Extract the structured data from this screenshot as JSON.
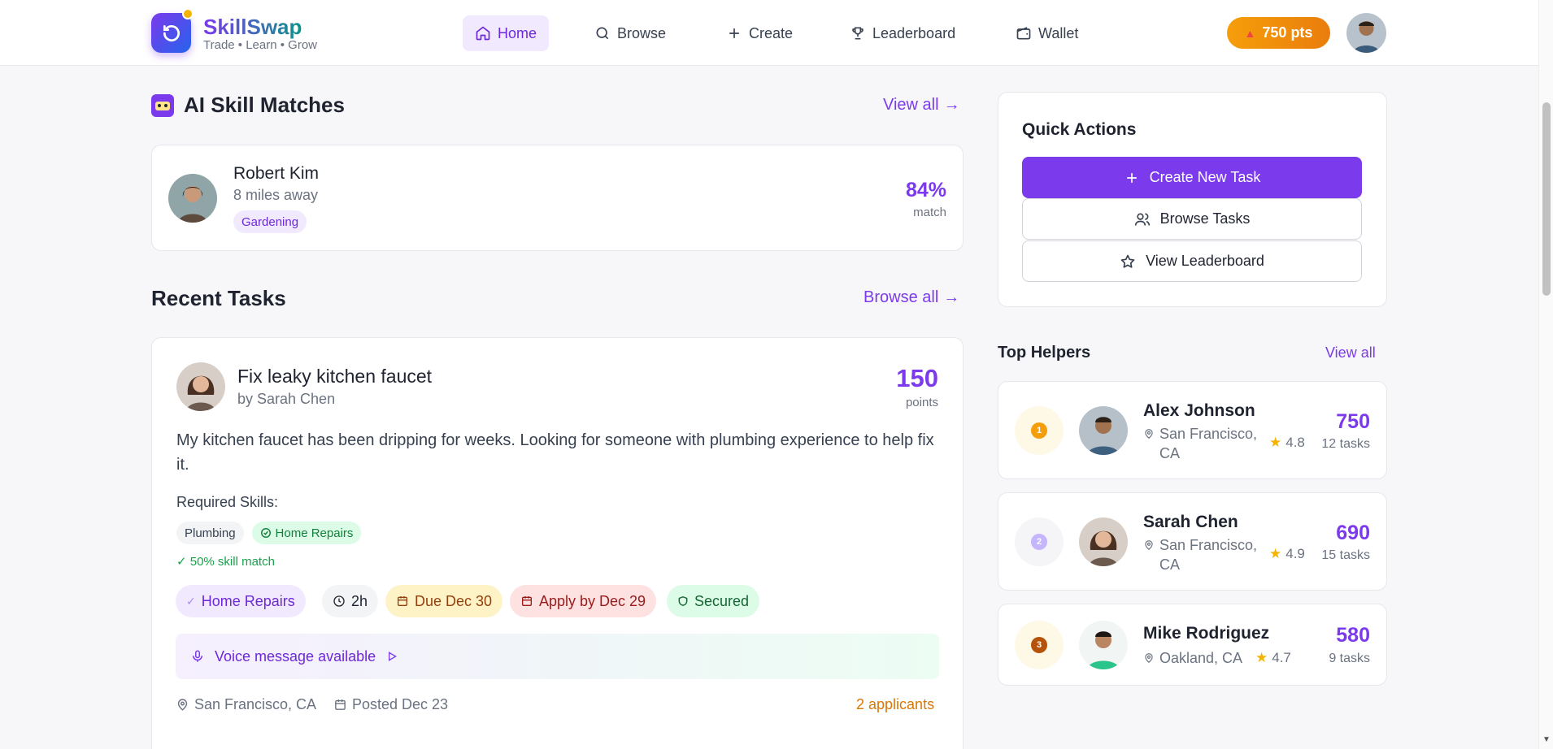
{
  "nav": {
    "brand": "SkillSwap",
    "tagline": "Trade • Learn • Grow",
    "items": [
      {
        "label": "Home",
        "icon": "home-icon",
        "active": true
      },
      {
        "label": "Browse",
        "icon": "search-icon"
      },
      {
        "label": "Create",
        "icon": "plus-icon"
      },
      {
        "label": "Leaderboard",
        "icon": "trophy-icon"
      },
      {
        "label": "Wallet",
        "icon": "wallet-icon"
      }
    ],
    "points": "750 pts"
  },
  "matches": {
    "title": "AI Skill Matches",
    "view_all": "View all",
    "item": {
      "name": "Robert Kim",
      "distance": "8 miles away",
      "skill": "Gardening",
      "percent": "84%",
      "match_label": "match"
    }
  },
  "recent": {
    "title": "Recent Tasks",
    "browse_all": "Browse all",
    "task": {
      "title": "Fix leaky kitchen faucet",
      "author": "by Sarah Chen",
      "points": "150",
      "points_label": "points",
      "description": "My kitchen faucet has been dripping for weeks. Looking for someone with plumbing experience to help fix it.",
      "skills_label": "Required Skills:",
      "skills": [
        "Plumbing",
        "Home Repairs"
      ],
      "skill_match": "✓ 50% skill match",
      "chips": {
        "category": "Home Repairs",
        "duration": "2h",
        "due": "Due Dec 30",
        "apply_by": "Apply by Dec 29",
        "secured": "Secured"
      },
      "voice": "Voice message available",
      "location": "San Francisco, CA",
      "posted": "Posted Dec 23",
      "applicants": "2 applicants"
    }
  },
  "quick_actions": {
    "title": "Quick Actions",
    "create": "Create New Task",
    "browse": "Browse Tasks",
    "leaderboard": "View Leaderboard"
  },
  "top_helpers": {
    "title": "Top Helpers",
    "view_all": "View all",
    "helpers": [
      {
        "rank": "1",
        "name": "Alex Johnson",
        "location": "San Francisco, CA",
        "rating": "4.8",
        "points": "750",
        "tasks": "12 tasks"
      },
      {
        "rank": "2",
        "name": "Sarah Chen",
        "location": "San Francisco, CA",
        "rating": "4.9",
        "points": "690",
        "tasks": "15 tasks"
      },
      {
        "rank": "3",
        "name": "Mike Rodriguez",
        "location": "Oakland, CA",
        "rating": "4.7",
        "points": "580",
        "tasks": "9 tasks"
      }
    ]
  },
  "colors": {
    "accent": "#7c3aed",
    "orange": "#f59e0b",
    "green": "#16a34a"
  }
}
